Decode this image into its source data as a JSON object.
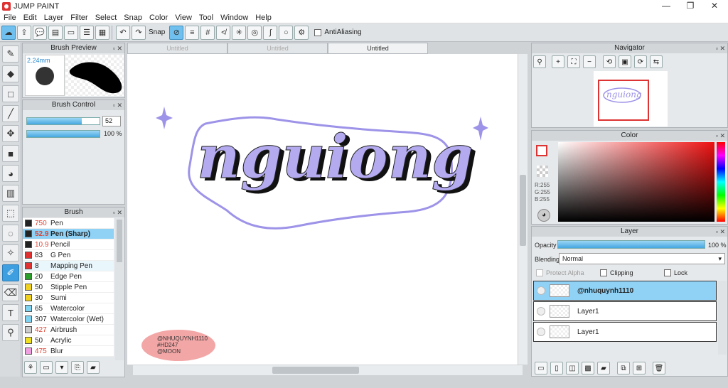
{
  "window": {
    "title": "JUMP PAINT",
    "minimize": "—",
    "maximize": "❐",
    "close": "✕"
  },
  "menu": [
    "File",
    "Edit",
    "Layer",
    "Filter",
    "Select",
    "Snap",
    "Color",
    "View",
    "Tool",
    "Window",
    "Help"
  ],
  "toolbar": {
    "snap_label": "Snap",
    "antialias_label": "AntiAliasing"
  },
  "tabs": [
    "Untitled",
    "Untitled",
    "Untitled"
  ],
  "brush_preview": {
    "title": "Brush Preview",
    "size": "2.24mm"
  },
  "brush_control": {
    "title": "Brush Control",
    "size_value": "52",
    "opacity_value": "100 %",
    "size_fraction": 0.75,
    "opacity_fraction": 1.0
  },
  "brush_list": {
    "title": "Brush",
    "items": [
      {
        "size": "750",
        "name": "Pen",
        "color": "#222222",
        "red_size": true
      },
      {
        "size": "52.9",
        "name": "Pen (Sharp)",
        "color": "#222222",
        "red_size": true,
        "selected": true
      },
      {
        "size": "10.9",
        "name": "Pencil",
        "color": "#222222",
        "red_size": true
      },
      {
        "size": "83",
        "name": "G Pen",
        "color": "#e03030"
      },
      {
        "size": "8",
        "name": "Mapping Pen",
        "color": "#e03030"
      },
      {
        "size": "20",
        "name": "Edge Pen",
        "color": "#2aa02a"
      },
      {
        "size": "50",
        "name": "Stipple Pen",
        "color": "#f0d020"
      },
      {
        "size": "30",
        "name": "Sumi",
        "color": "#f0d020"
      },
      {
        "size": "65",
        "name": "Watercolor",
        "color": "#7fd3f0"
      },
      {
        "size": "307",
        "name": "Watercolor (Wet)",
        "color": "#7fd3f0"
      },
      {
        "size": "427",
        "name": "Airbrush",
        "color": "#cccccc",
        "red_size": true
      },
      {
        "size": "50",
        "name": "Acrylic",
        "color": "#f0e020"
      },
      {
        "size": "475",
        "name": "Blur",
        "color": "#f0a0e0",
        "red_size": true
      }
    ]
  },
  "canvas": {
    "lettering": "nguiong",
    "tag_lines": [
      "@NHUQUYNH1110",
      "#HD247",
      "@MOON"
    ],
    "accent": "#9d93e8",
    "tag_color": "#f3a6a6"
  },
  "navigator": {
    "title": "Navigator"
  },
  "color": {
    "title": "Color",
    "r": "R:255",
    "g": "G:255",
    "b": "B:255"
  },
  "layer": {
    "title": "Layer",
    "opacity_label": "Opacity",
    "opacity_value": "100 %",
    "blending_label": "Blending",
    "blending_value": "Normal",
    "protect_alpha": "Protect Alpha",
    "clipping": "Clipping",
    "lock": "Lock",
    "layers": [
      {
        "name": "@nhuquynh1110",
        "selected": true
      },
      {
        "name": "Layer1"
      },
      {
        "name": "Layer1"
      }
    ]
  }
}
